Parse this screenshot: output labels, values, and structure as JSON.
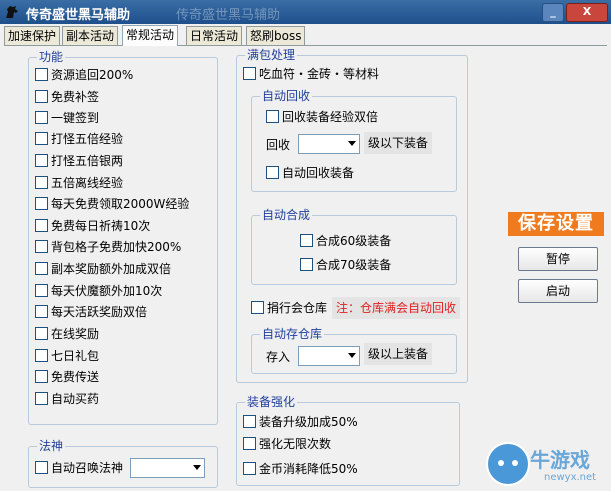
{
  "window": {
    "title": "传奇盛世黑马辅助",
    "ghost_title": "传奇盛世黑马辅助",
    "close_label": "X"
  },
  "tabs": [
    "加速保护",
    "副本活动",
    "常规活动",
    "日常活动",
    "怒刷boss"
  ],
  "active_tab": 2,
  "function_group": {
    "legend": "功能",
    "items": [
      "资源追回200%",
      "免费补签",
      "一键签到",
      "打怪五倍经验",
      "打怪五倍银两",
      "五倍离线经验",
      "每天免费领取2000W经验",
      "免费每日祈祷10次",
      "背包格子免费加快200%",
      "副本奖励额外加成双倍",
      "每天伏魔额外加10次",
      "每天活跃奖励双倍",
      "在线奖励",
      "七日礼包",
      "免费传送",
      "自动买药"
    ]
  },
  "fashen_group": {
    "legend": "法神",
    "auto_summon": "自动召唤法神",
    "select_value": ""
  },
  "bag_group": {
    "legend": "满包处理",
    "eat_items": "吃血符・金砖・等材料",
    "auto_recycle": {
      "legend": "自动回收",
      "double_exp": "回收装备经验双倍",
      "recycle_label": "回收",
      "recycle_value": "",
      "level_below": "级以下装备",
      "auto_recycle_equip": "自动回收装备"
    },
    "auto_merge": {
      "legend": "自动合成",
      "merge60": "合成60级装备",
      "merge70": "合成70级装备"
    },
    "donate": "捐行会仓库",
    "donate_note": "注：仓库满会自动回收",
    "auto_store": {
      "legend": "自动存仓库",
      "store_label": "存入",
      "store_value": "",
      "level_above": "级以上装备"
    }
  },
  "enhance_group": {
    "legend": "装备强化",
    "items": [
      "装备升级加成50%",
      "强化无限次数",
      "金币消耗降低50%"
    ]
  },
  "buttons": {
    "save": "保存设置",
    "pause": "暂停",
    "start": "启动"
  },
  "watermark": {
    "brand": "牛游戏",
    "url": "newyx.net"
  }
}
